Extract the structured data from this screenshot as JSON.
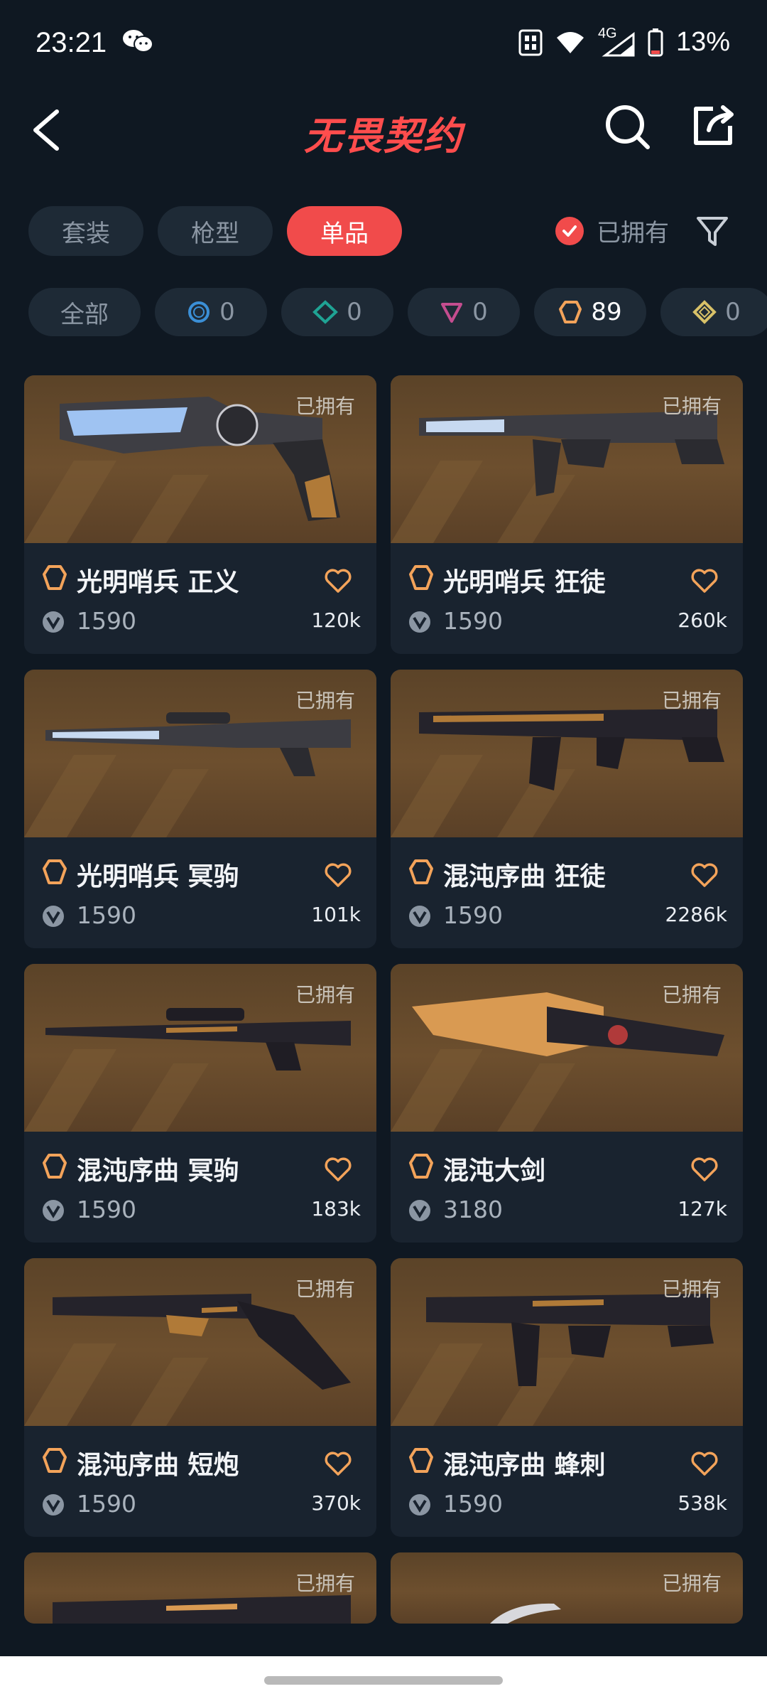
{
  "status_bar": {
    "time": "23:21",
    "network": "4G",
    "battery": "13%"
  },
  "header": {
    "title": "无畏契约"
  },
  "tabs": [
    {
      "label": "套装",
      "active": false
    },
    {
      "label": "枪型",
      "active": false
    },
    {
      "label": "单品",
      "active": true
    }
  ],
  "owned_filter": {
    "label": "已拥有",
    "checked": true
  },
  "chips": [
    {
      "label": "全部"
    },
    {
      "icon": "select-tier-icon",
      "count": "0",
      "color": "#3b8fd6"
    },
    {
      "icon": "deluxe-tier-icon",
      "count": "0",
      "color": "#1fa394"
    },
    {
      "icon": "premium-tier-icon",
      "count": "0",
      "color": "#c44d8f"
    },
    {
      "icon": "exclusive-tier-icon",
      "count": "89",
      "color": "#f3a35a"
    },
    {
      "icon": "ultra-tier-icon",
      "count": "0",
      "color": "#d8c168"
    }
  ],
  "cards": [
    {
      "owned": "已拥有",
      "name": "光明哨兵 正义",
      "price": "1590",
      "likes": "120k"
    },
    {
      "owned": "已拥有",
      "name": "光明哨兵 狂徒",
      "price": "1590",
      "likes": "260k"
    },
    {
      "owned": "已拥有",
      "name": "光明哨兵 冥驹",
      "price": "1590",
      "likes": "101k"
    },
    {
      "owned": "已拥有",
      "name": "混沌序曲 狂徒",
      "price": "1590",
      "likes": "2286k"
    },
    {
      "owned": "已拥有",
      "name": "混沌序曲 冥驹",
      "price": "1590",
      "likes": "183k"
    },
    {
      "owned": "已拥有",
      "name": "混沌大剑",
      "price": "3180",
      "likes": "127k"
    },
    {
      "owned": "已拥有",
      "name": "混沌序曲 短炮",
      "price": "1590",
      "likes": "370k"
    },
    {
      "owned": "已拥有",
      "name": "混沌序曲 蜂刺",
      "price": "1590",
      "likes": "538k"
    },
    {
      "owned": "已拥有"
    },
    {
      "owned": "已拥有"
    }
  ],
  "colors": {
    "accent": "#f14b4b",
    "tier": "#f3a35a",
    "background": "#0f1822"
  }
}
